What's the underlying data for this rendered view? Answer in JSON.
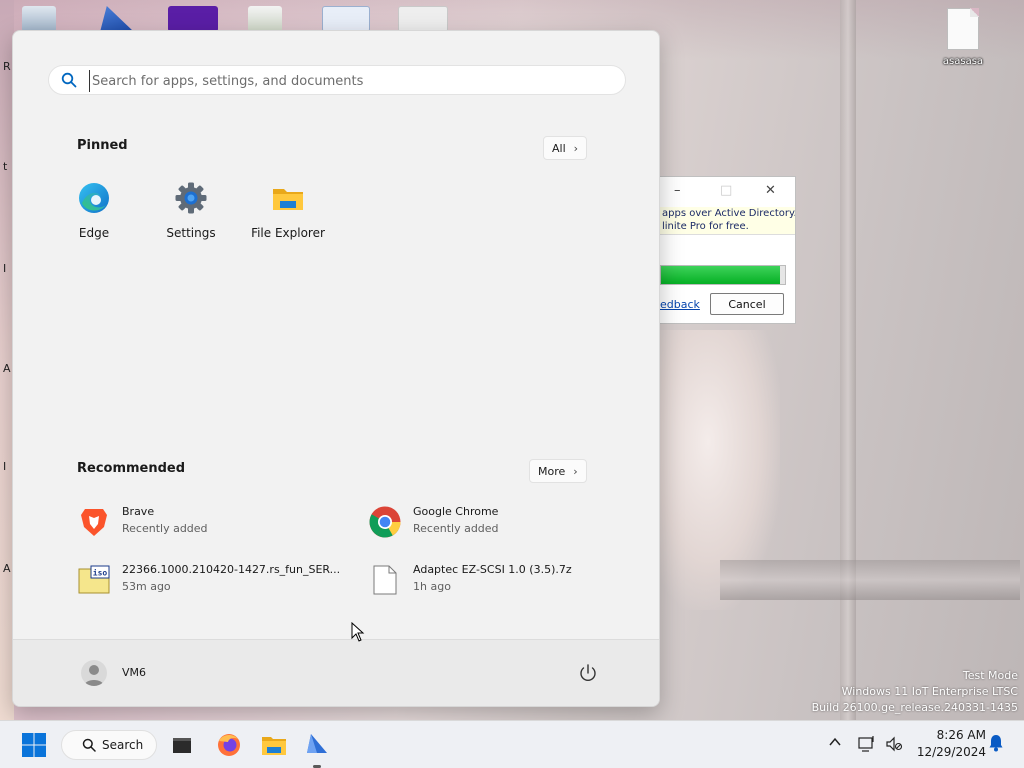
{
  "desktop": {
    "left_glyphs": [
      "R",
      "t",
      "I",
      "A",
      "I",
      "A"
    ],
    "file_label": "asasasa",
    "watermark": {
      "line1": "Test Mode",
      "line2": "Windows 11 IoT Enterprise LTSC",
      "line3": "Build 26100.ge_release.240331-1435"
    }
  },
  "background_dialog": {
    "minimize_glyph": "–",
    "maximize_glyph": "□",
    "close_glyph": "✕",
    "banner_line1": "apps over Active Directory.",
    "banner_line2": "linite Pro for free.",
    "progress_fraction": 0.96,
    "feedback_link": "edback",
    "cancel_label": "Cancel"
  },
  "start_menu": {
    "search": {
      "placeholder": "Search for apps, settings, and documents",
      "value": ""
    },
    "pinned": {
      "title": "Pinned",
      "all_label": "All",
      "apps": [
        {
          "label": "Edge",
          "icon": "edge-icon"
        },
        {
          "label": "Settings",
          "icon": "gear-icon"
        },
        {
          "label": "File Explorer",
          "icon": "folder-icon"
        }
      ]
    },
    "recommended": {
      "title": "Recommended",
      "more_label": "More",
      "items": [
        {
          "name": "Brave",
          "sub": "Recently added",
          "icon": "brave-icon"
        },
        {
          "name": "Google Chrome",
          "sub": "Recently added",
          "icon": "chrome-icon"
        },
        {
          "name": "22366.1000.210420-1427.rs_fun_SER...",
          "sub": "53m ago",
          "icon": "iso-file-icon"
        },
        {
          "name": "Adaptec EZ-SCSI 1.0 (3.5).7z",
          "sub": "1h ago",
          "icon": "file-icon"
        }
      ]
    },
    "footer": {
      "user_name": "VM6"
    }
  },
  "taskbar": {
    "search_label": "Search",
    "apps": [
      "start-icon",
      "search-icon",
      "terminal-icon",
      "firefox-icon",
      "file-explorer-icon",
      "app-icon"
    ],
    "clock": {
      "time": "8:26 AM",
      "date": "12/29/2024"
    }
  },
  "colors": {
    "accent": "#0067c0",
    "progress_green": "#06b025",
    "edge_blue": "#1b9de2",
    "chrome_red": "#db4437"
  }
}
